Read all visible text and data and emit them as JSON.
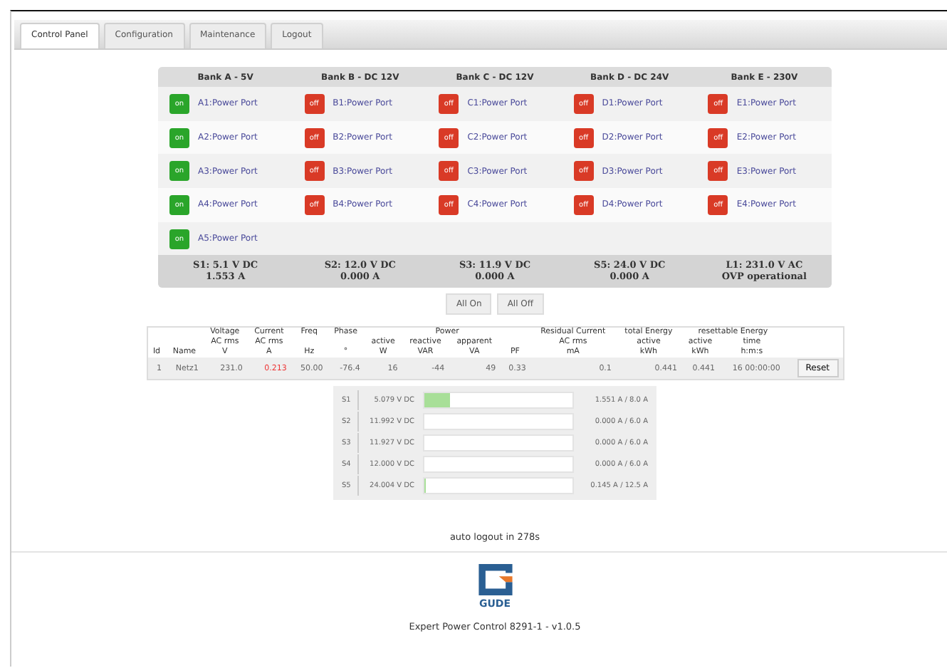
{
  "tabs": [
    {
      "label": "Control Panel",
      "selected": true
    },
    {
      "label": "Configuration",
      "selected": false
    },
    {
      "label": "Maintenance",
      "selected": false
    },
    {
      "label": "Logout",
      "selected": false
    }
  ],
  "banks": [
    {
      "title": "Bank A - 5V",
      "ports": [
        {
          "switch": "on",
          "on": true,
          "name": "A1:Power Port"
        },
        {
          "switch": "on",
          "on": true,
          "name": "A2:Power Port"
        },
        {
          "switch": "on",
          "on": true,
          "name": "A3:Power Port"
        },
        {
          "switch": "on",
          "on": true,
          "name": "A4:Power Port"
        },
        {
          "switch": "on",
          "on": true,
          "name": "A5:Power Port"
        }
      ],
      "summary": [
        "S1: 5.1 V DC",
        "1.553 A"
      ]
    },
    {
      "title": "Bank B - DC 12V",
      "ports": [
        {
          "switch": "off",
          "on": false,
          "name": "B1:Power Port"
        },
        {
          "switch": "off",
          "on": false,
          "name": "B2:Power Port"
        },
        {
          "switch": "off",
          "on": false,
          "name": "B3:Power Port"
        },
        {
          "switch": "off",
          "on": false,
          "name": "B4:Power Port"
        }
      ],
      "summary": [
        "S2: 12.0 V DC",
        "0.000 A"
      ]
    },
    {
      "title": "Bank C - DC 12V",
      "ports": [
        {
          "switch": "off",
          "on": false,
          "name": "C1:Power Port"
        },
        {
          "switch": "off",
          "on": false,
          "name": "C2:Power Port"
        },
        {
          "switch": "off",
          "on": false,
          "name": "C3:Power Port"
        },
        {
          "switch": "off",
          "on": false,
          "name": "C4:Power Port"
        }
      ],
      "summary": [
        "S3: 11.9 V DC",
        "0.000 A"
      ]
    },
    {
      "title": "Bank D - DC 24V",
      "ports": [
        {
          "switch": "off",
          "on": false,
          "name": "D1:Power Port"
        },
        {
          "switch": "off",
          "on": false,
          "name": "D2:Power Port"
        },
        {
          "switch": "off",
          "on": false,
          "name": "D3:Power Port"
        },
        {
          "switch": "off",
          "on": false,
          "name": "D4:Power Port"
        }
      ],
      "summary": [
        "S5: 24.0 V DC",
        "0.000 A"
      ]
    },
    {
      "title": "Bank E - 230V",
      "ports": [
        {
          "switch": "off",
          "on": false,
          "name": "E1:Power Port"
        },
        {
          "switch": "off",
          "on": false,
          "name": "E2:Power Port"
        },
        {
          "switch": "off",
          "on": false,
          "name": "E3:Power Port"
        },
        {
          "switch": "off",
          "on": false,
          "name": "E4:Power Port"
        }
      ],
      "summary": [
        "L1: 231.0 V AC",
        "OVP operational"
      ]
    }
  ],
  "all_buttons": [
    "All On",
    "All Off"
  ],
  "measurements": {
    "header": [
      {
        "label": "Id"
      },
      {
        "label": "Name"
      },
      {
        "label": "Voltage\nAC rms\nV"
      },
      {
        "label": "Current\nAC rms\nA"
      },
      {
        "label": "Freq\n\nHz"
      },
      {
        "label": "Phase\n\n°"
      },
      {
        "label": "Power",
        "children": [
          {
            "label": "active\nW"
          },
          {
            "label": "reactive\nVAR"
          },
          {
            "label": "apparent\nVA"
          },
          {
            "label": "PF"
          }
        ]
      },
      {
        "label": "Residual Current\nAC rms\nmA"
      },
      {
        "label": "total Energy\nactive\nkWh"
      },
      {
        "label": "resettable Energy",
        "children": [
          {
            "label": "active\nkWh"
          },
          {
            "label": "time\nh:m:s"
          }
        ]
      }
    ],
    "rows": [
      {
        "cells": [
          {
            "text": "1",
            "warning": false
          },
          {
            "text": "Netz1",
            "warning": false
          },
          {
            "text": "231.0",
            "warning": false
          },
          {
            "text": "0.213",
            "warning": true
          },
          {
            "text": "50.00",
            "warning": false
          },
          {
            "text": "-76.4",
            "warning": false
          },
          {
            "text": "16",
            "warning": false
          },
          {
            "text": "-44",
            "warning": false
          },
          {
            "text": "49",
            "warning": false
          },
          {
            "text": "0.33",
            "warning": false
          },
          {
            "text": "0.1",
            "warning": false
          },
          {
            "text": "0.441",
            "warning": false
          },
          {
            "text": "0.441",
            "warning": false
          },
          {
            "text": "16 00:00:00",
            "warning": false
          }
        ],
        "button": "Reset"
      }
    ]
  },
  "sensors": [
    {
      "id": "S1",
      "voltage": "5.079 V DC",
      "level": 0.17,
      "current": "1.551 A / 8.0 A"
    },
    {
      "id": "S2",
      "voltage": "11.992 V DC",
      "level": 0,
      "current": "0.000 A / 6.0 A"
    },
    {
      "id": "S3",
      "voltage": "11.927 V DC",
      "level": 0,
      "current": "0.000 A / 6.0 A"
    },
    {
      "id": "S4",
      "voltage": "12.000 V DC",
      "level": 0,
      "current": "0.000 A / 6.0 A"
    },
    {
      "id": "S5",
      "voltage": "24.004 V DC",
      "level": 0.01,
      "current": "0.145 A / 12.5 A"
    }
  ],
  "auto_logout": "auto logout in 278s",
  "footer": {
    "logo_text": "GUDE",
    "product": "Expert Power Control 8291-1 - v1.0.5"
  }
}
